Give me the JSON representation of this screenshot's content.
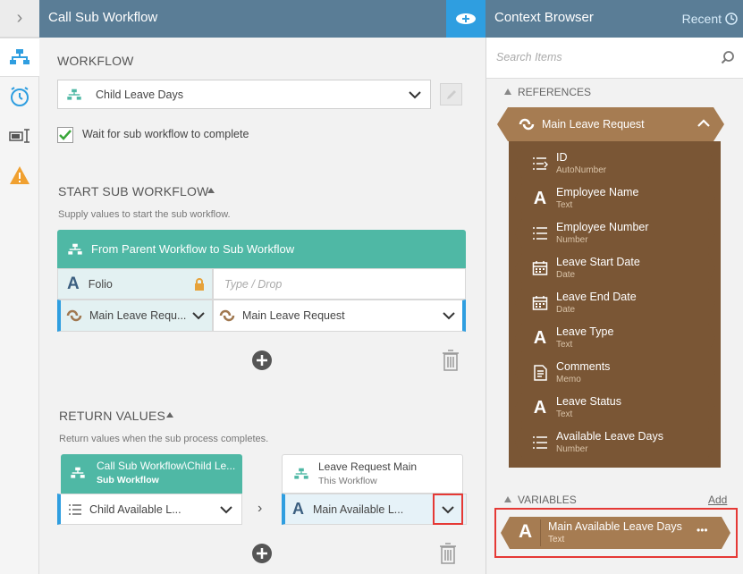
{
  "header": {
    "title": "Call Sub Workflow"
  },
  "workflow": {
    "section_label": "WORKFLOW",
    "selected": "Child Leave Days",
    "wait_label": "Wait for sub workflow to complete",
    "wait_checked": true
  },
  "start": {
    "section_label": "START SUB WORKFLOW",
    "description": "Supply values to start the sub workflow.",
    "mapping_title": "From Parent Workflow to Sub Workflow",
    "row1_left": "Folio",
    "row1_right_placeholder": "Type / Drop",
    "row2_left": "Main Leave Requ...",
    "row2_right": "Main Leave Request"
  },
  "return": {
    "section_label": "RETURN VALUES",
    "description": "Return values when the sub process completes.",
    "left_title": "Call Sub Workflow\\Child Le...",
    "left_subtitle": "Sub Workflow",
    "right_title": "Leave Request Main",
    "right_subtitle": "This Workflow",
    "left_value": "Child Available L...",
    "right_value": "Main Available L...",
    "arrow": "›"
  },
  "context": {
    "title": "Context Browser",
    "recent_label": "Recent",
    "search_placeholder": "Search Items",
    "references_label": "REFERENCES",
    "reference_title": "Main Leave Request",
    "items": [
      {
        "name": "ID",
        "type": "AutoNumber",
        "icon": "autonumber-icon"
      },
      {
        "name": "Employee Name",
        "type": "Text",
        "icon": "text-icon"
      },
      {
        "name": "Employee Number",
        "type": "Number",
        "icon": "number-icon"
      },
      {
        "name": "Leave Start Date",
        "type": "Date",
        "icon": "date-icon"
      },
      {
        "name": "Leave End Date",
        "type": "Date",
        "icon": "date-icon"
      },
      {
        "name": "Leave Type",
        "type": "Text",
        "icon": "text-icon"
      },
      {
        "name": "Comments",
        "type": "Memo",
        "icon": "memo-icon"
      },
      {
        "name": "Leave Status",
        "type": "Text",
        "icon": "text-icon"
      },
      {
        "name": "Available Leave Days",
        "type": "Number",
        "icon": "number-icon"
      }
    ],
    "variables_label": "VARIABLES",
    "add_label": "Add",
    "variable": {
      "name": "Main Available Leave Days",
      "type": "Text",
      "more": "•••"
    }
  },
  "colors": {
    "header": "#5a7d96",
    "accent": "#2f9ee0",
    "teal": "#4fb8a5",
    "brown_dark": "#7a5635",
    "brown_light": "#a67c52",
    "highlight": "#e53935"
  }
}
